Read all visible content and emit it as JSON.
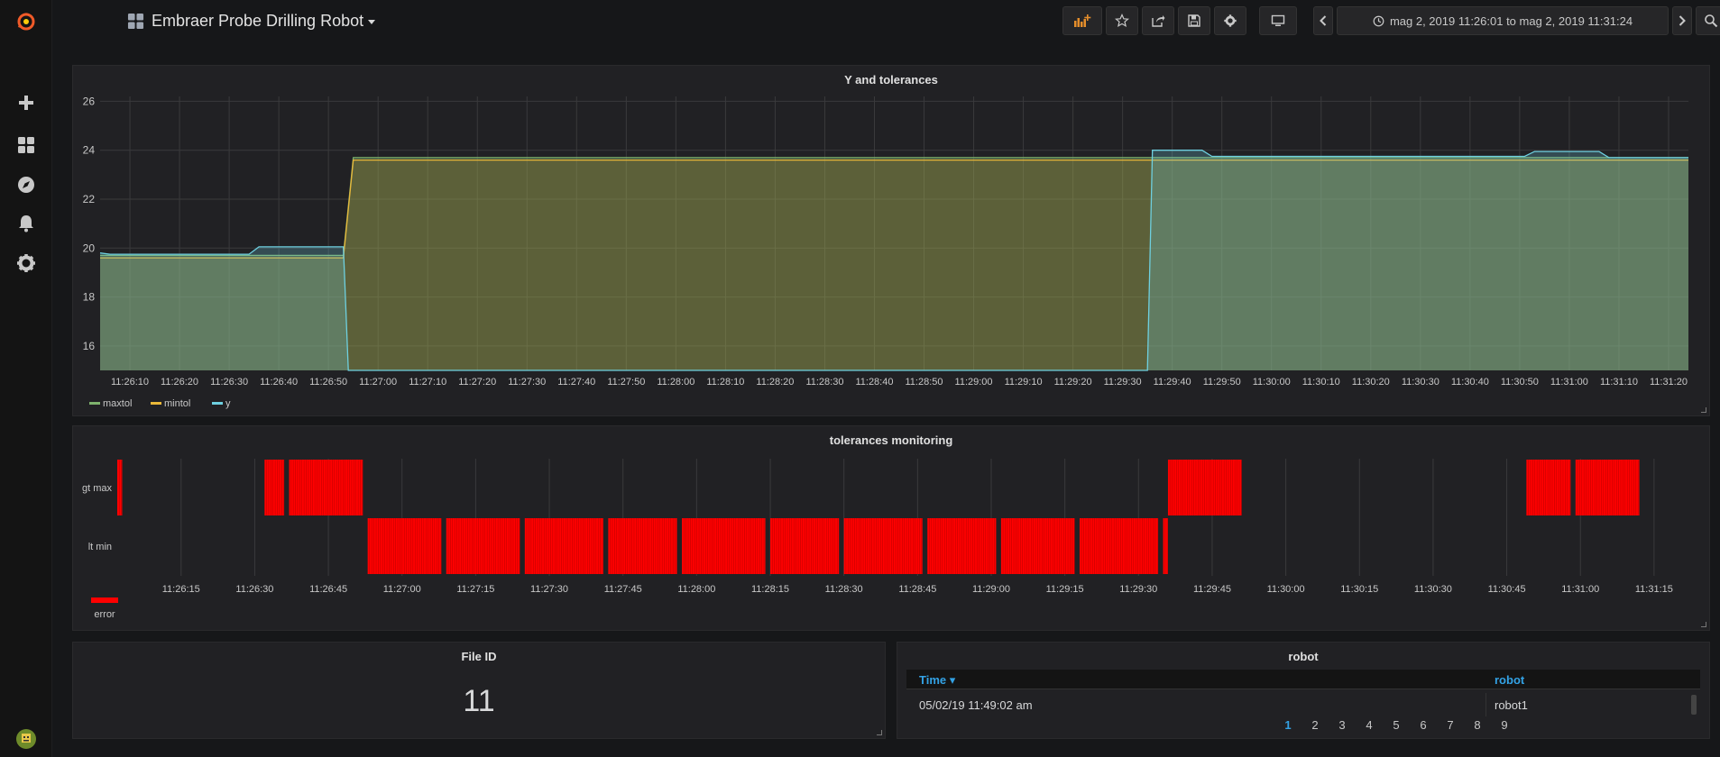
{
  "sidebar": {
    "items": [
      {
        "name": "grafana-logo"
      },
      {
        "name": "plus-icon"
      },
      {
        "name": "dashboards-icon"
      },
      {
        "name": "explore-icon"
      },
      {
        "name": "alert-bell-icon"
      },
      {
        "name": "gear-icon"
      }
    ]
  },
  "header": {
    "title": "Embraer Probe Drilling Robot",
    "time_range": "mag 2, 2019 11:26:01 to mag 2, 2019 11:31:24"
  },
  "panels": {
    "y_tol": {
      "title": "Y and tolerances",
      "legend": [
        "maxtol",
        "mintol",
        "y"
      ]
    },
    "tol_mon": {
      "title": "tolerances monitoring",
      "rows": [
        "gt max",
        "lt min"
      ],
      "legend": "error"
    },
    "file_id": {
      "title": "File ID",
      "value": "11"
    },
    "robot": {
      "title": "robot",
      "columns": [
        "Time",
        "robot"
      ],
      "rows": [
        [
          "05/02/19 11:49:02 am",
          "robot1"
        ]
      ],
      "pages": [
        "1",
        "2",
        "3",
        "4",
        "5",
        "6",
        "7",
        "8",
        "9"
      ]
    }
  },
  "colors": {
    "maxtol": "#7eb26d",
    "mintol": "#eab839",
    "y": "#6ed0e0",
    "error": "#ff0000"
  },
  "chart_data": [
    {
      "type": "area",
      "title": "Y and tolerances",
      "x_ticks": [
        "11:26:10",
        "11:26:20",
        "11:26:30",
        "11:26:40",
        "11:26:50",
        "11:27:00",
        "11:27:10",
        "11:27:20",
        "11:27:30",
        "11:27:40",
        "11:27:50",
        "11:28:00",
        "11:28:10",
        "11:28:20",
        "11:28:30",
        "11:28:40",
        "11:28:50",
        "11:29:00",
        "11:29:10",
        "11:29:20",
        "11:29:30",
        "11:29:40",
        "11:29:50",
        "11:30:00",
        "11:30:10",
        "11:30:20",
        "11:30:30",
        "11:30:40",
        "11:30:50",
        "11:31:00",
        "11:31:10",
        "11:31:20"
      ],
      "x_range": [
        "11:26:04",
        "11:31:24"
      ],
      "y_ticks": [
        16,
        18,
        20,
        22,
        24,
        26
      ],
      "ylim": [
        15,
        26.2
      ],
      "grid": true,
      "legend": "bottom-left",
      "series": [
        {
          "name": "maxtol",
          "points": [
            [
              "11:26:04",
              19.7
            ],
            [
              "11:26:53",
              19.7
            ],
            [
              "11:26:55",
              23.7
            ],
            [
              "11:29:37",
              23.7
            ],
            [
              "11:29:37.5",
              23.7
            ],
            [
              "11:31:24",
              23.7
            ]
          ]
        },
        {
          "name": "mintol",
          "points": [
            [
              "11:26:04",
              19.6
            ],
            [
              "11:26:53",
              19.6
            ],
            [
              "11:26:55",
              23.6
            ],
            [
              "11:29:37",
              23.6
            ],
            [
              "11:29:37.5",
              23.6
            ],
            [
              "11:31:24",
              23.6
            ]
          ]
        },
        {
          "name": "y",
          "points": [
            [
              "11:26:04",
              19.8
            ],
            [
              "11:26:06",
              19.75
            ],
            [
              "11:26:34",
              19.75
            ],
            [
              "11:26:36",
              20.05
            ],
            [
              "11:26:53",
              20.05
            ],
            [
              "11:26:54",
              15.0
            ],
            [
              "11:29:35",
              15.0
            ],
            [
              "11:29:36",
              24.0
            ],
            [
              "11:29:46",
              24.0
            ],
            [
              "11:29:48",
              23.75
            ],
            [
              "11:30:51",
              23.75
            ],
            [
              "11:30:53",
              23.95
            ],
            [
              "11:31:06",
              23.95
            ],
            [
              "11:31:08",
              23.7
            ],
            [
              "11:31:24",
              23.7
            ]
          ]
        }
      ]
    },
    {
      "type": "heatmap",
      "title": "tolerances monitoring",
      "x_ticks": [
        "11:26:15",
        "11:26:30",
        "11:26:45",
        "11:27:00",
        "11:27:15",
        "11:27:30",
        "11:27:45",
        "11:28:00",
        "11:28:15",
        "11:28:30",
        "11:28:45",
        "11:29:00",
        "11:29:15",
        "11:29:30",
        "11:29:45",
        "11:30:00",
        "11:30:15",
        "11:30:30",
        "11:30:45",
        "11:31:00",
        "11:31:15"
      ],
      "x_range": [
        "11:26:02",
        "11:31:22"
      ],
      "rows": [
        "gt max",
        "lt min"
      ],
      "series": [
        {
          "name": "gt max",
          "intervals": [
            [
              "11:26:02",
              "11:26:03"
            ],
            [
              "11:26:32",
              "11:26:36"
            ],
            [
              "11:26:37",
              "11:26:52"
            ],
            [
              "11:29:36",
              "11:29:51"
            ],
            [
              "11:30:49",
              "11:30:58"
            ],
            [
              "11:30:59",
              "11:31:12"
            ]
          ]
        },
        {
          "name": "lt min",
          "intervals": [
            [
              "11:26:53",
              "11:27:08"
            ],
            [
              "11:27:09",
              "11:27:24"
            ],
            [
              "11:27:25",
              "11:27:41"
            ],
            [
              "11:27:42",
              "11:27:56"
            ],
            [
              "11:27:57",
              "11:28:14"
            ],
            [
              "11:28:15",
              "11:28:29"
            ],
            [
              "11:28:30",
              "11:28:46"
            ],
            [
              "11:28:47",
              "11:29:01"
            ],
            [
              "11:29:02",
              "11:29:17"
            ],
            [
              "11:29:18",
              "11:29:34"
            ],
            [
              "11:29:35",
              "11:29:36"
            ]
          ]
        }
      ]
    }
  ]
}
